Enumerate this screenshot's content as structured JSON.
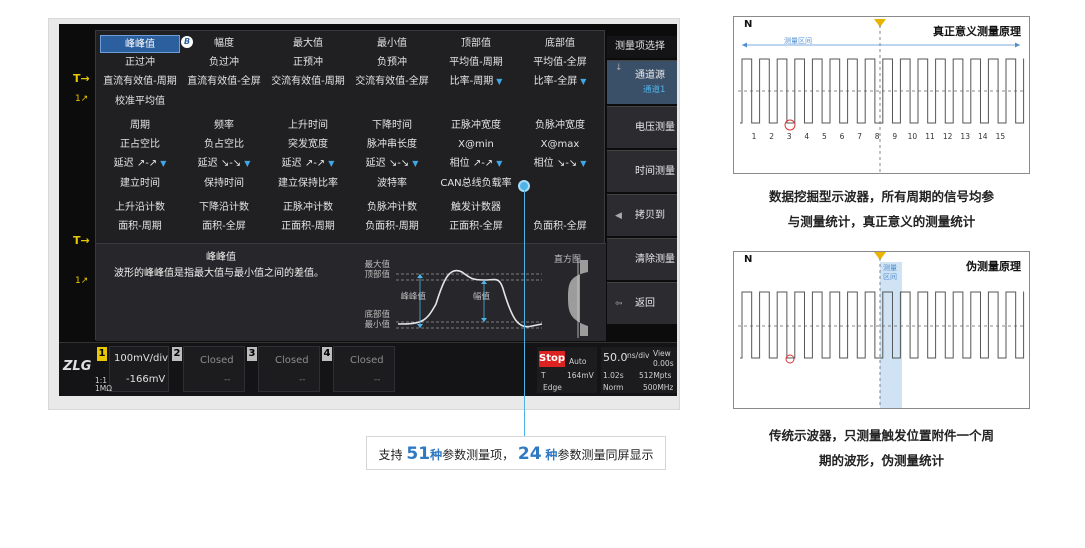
{
  "scope": {
    "left_markers": [
      {
        "label": "T→"
      },
      {
        "label": "1↗"
      },
      {
        "label": "T→"
      },
      {
        "label": "1↗"
      }
    ],
    "measure_rows": [
      {
        "cells": [
          {
            "label": "峰峰值",
            "selected": true,
            "badge": "B"
          },
          {
            "label": "幅度"
          },
          {
            "label": "最大值"
          },
          {
            "label": "最小值"
          },
          {
            "label": "顶部值"
          },
          {
            "label": "底部值"
          }
        ]
      },
      {
        "cells": [
          {
            "label": "正过冲"
          },
          {
            "label": "负过冲"
          },
          {
            "label": "正预冲"
          },
          {
            "label": "负预冲"
          },
          {
            "label": "平均值-周期"
          },
          {
            "label": "平均值-全屏"
          }
        ]
      },
      {
        "cells": [
          {
            "label": "直流有效值-周期"
          },
          {
            "label": "直流有效值-全屏"
          },
          {
            "label": "交流有效值-周期"
          },
          {
            "label": "交流有效值-全屏"
          },
          {
            "label": "比率-周期",
            "dropdown": true
          },
          {
            "label": "比率-全屏",
            "dropdown": true
          }
        ]
      },
      {
        "cells": [
          {
            "label": "校准平均值"
          }
        ]
      },
      {
        "cells": [
          {
            "label": "周期"
          },
          {
            "label": "频率"
          },
          {
            "label": "上升时间"
          },
          {
            "label": "下降时间"
          },
          {
            "label": "正脉冲宽度"
          },
          {
            "label": "负脉冲宽度"
          }
        ]
      },
      {
        "cells": [
          {
            "label": "正占空比"
          },
          {
            "label": "负占空比"
          },
          {
            "label": "突发宽度"
          },
          {
            "label": "脉冲串长度"
          },
          {
            "label": "X@min"
          },
          {
            "label": "X@max"
          }
        ]
      },
      {
        "cells": [
          {
            "label": "延迟 ↗-↗",
            "dropdown": true
          },
          {
            "label": "延迟 ↘-↘",
            "dropdown": true
          },
          {
            "label": "延迟 ↗-↗",
            "dropdown": true
          },
          {
            "label": "延迟 ↘-↘",
            "dropdown": true
          },
          {
            "label": "相位 ↗-↗",
            "dropdown": true
          },
          {
            "label": "相位 ↘-↘",
            "dropdown": true
          }
        ]
      },
      {
        "cells": [
          {
            "label": "建立时间"
          },
          {
            "label": "保持时间"
          },
          {
            "label": "建立保持比率"
          },
          {
            "label": "波特率"
          },
          {
            "label": "CAN总线负载率"
          }
        ]
      },
      {
        "cells": [
          {
            "label": "上升沿计数"
          },
          {
            "label": "下降沿计数"
          },
          {
            "label": "正脉冲计数"
          },
          {
            "label": "负脉冲计数"
          },
          {
            "label": "触发计数器"
          }
        ]
      },
      {
        "cells": [
          {
            "label": "面积-周期"
          },
          {
            "label": "面积-全屏"
          },
          {
            "label": "正面积-周期"
          },
          {
            "label": "负面积-周期"
          },
          {
            "label": "正面积-全屏"
          },
          {
            "label": "负面积-全屏"
          }
        ]
      }
    ],
    "description": {
      "title": "峰峰值",
      "text": "波形的峰峰值是指最大值与最小值之间的差值。",
      "labels": {
        "max_top": "最大值\n顶部值",
        "pp": "峰峰值",
        "amp": "幅值",
        "bottom_min": "底部值\n最小值",
        "histogram": "直方图"
      }
    },
    "side_menu": {
      "title": "测量项选择",
      "items": [
        {
          "label": "通道源",
          "sub": "通道1",
          "active": true
        },
        {
          "label": "电压测量"
        },
        {
          "label": "时间测量"
        },
        {
          "label": "拷贝到",
          "arrow": true
        },
        {
          "label": "清除测量"
        },
        {
          "label": "返回"
        }
      ]
    },
    "bottom": {
      "logo": "ZLG",
      "ch1": {
        "num": "1",
        "scale": "100mV/div",
        "offset": "-166mV",
        "coupling": "1:1\n1MΩ"
      },
      "ch2": {
        "num": "2",
        "status": "Closed",
        "dash": "--"
      },
      "ch3": {
        "num": "3",
        "status": "Closed",
        "dash": "--"
      },
      "ch4": {
        "num": "4",
        "status": "Closed",
        "dash": "--"
      },
      "trigger": {
        "state": "Stop",
        "mode": "Auto",
        "type": "T",
        "level": "164mV",
        "edge": "Edge"
      },
      "timebase": {
        "scale": "50.0",
        "unit": "ns/div",
        "view": "View",
        "offset": "0.00s",
        "time": "1.02s",
        "rate": "512Mpts",
        "norm": "Norm",
        "bw": "500MHz"
      }
    }
  },
  "callout": {
    "prefix": "支持",
    "n1": "51",
    "mid1": "种",
    "mid2": "参数测量项，",
    "n2": "24",
    "mid3": "种",
    "suffix": "参数测量同屏显示"
  },
  "diagram_true": {
    "title": "真正意义测量原理",
    "n_label": "N",
    "region_label": "测量区间",
    "period_numbers": [
      "1",
      "2",
      "3",
      "4",
      "5",
      "6",
      "7",
      "8",
      "9",
      "10",
      "11",
      "12",
      "13",
      "14",
      "15"
    ],
    "caption_line1": "数据挖掘型示波器，所有周期的信号均参",
    "caption_line2": "与测量统计，真正意义的测量统计"
  },
  "diagram_pseudo": {
    "title": "伪测量原理",
    "n_label": "N",
    "region_label_1": "测量",
    "region_label_2": "区间",
    "caption_line1": "传统示波器，只测量触发位置附件一个周",
    "caption_line2": "期的波形，伪测量统计"
  },
  "colors": {
    "accent_blue": "#2f78c4",
    "selected_bg": "#2b5f9e",
    "trigger_yellow": "#e8c800",
    "stop_red": "#dd2222",
    "cursor_blue": "#4fb3e8"
  }
}
